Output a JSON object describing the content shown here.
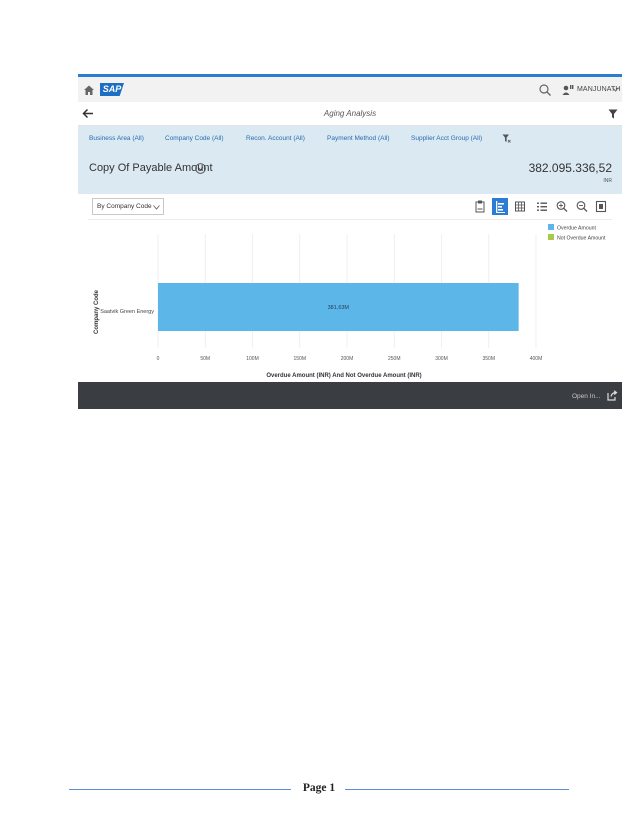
{
  "shell": {
    "logo": "SAP",
    "user_name": "MANJUNATH"
  },
  "app": {
    "title": "Aging Analysis"
  },
  "filters": [
    {
      "label": "Business Area (All)"
    },
    {
      "label": "Company Code (All)"
    },
    {
      "label": "Recon. Account (All)"
    },
    {
      "label": "Payment Method (All)"
    },
    {
      "label": "Supplier Acct Group (All)"
    }
  ],
  "kpi": {
    "title": "Copy Of Payable Amount",
    "value": "382.095.336,52",
    "unit": "INR"
  },
  "toolbar": {
    "dropdown_label": "By Company Code",
    "active_view": "bar-chart"
  },
  "colors": {
    "overdue": "#5cb6e8",
    "not_overdue": "#a8c94a",
    "accent": "#2b7cd3",
    "filter_bg": "#dbe9f2"
  },
  "chart_data": {
    "type": "bar",
    "orientation": "horizontal",
    "categories": [
      "Saatvik Green Energy"
    ],
    "series": [
      {
        "name": "Overdue Amount",
        "values": [
          381.63
        ],
        "labels": [
          "381,63M"
        ]
      },
      {
        "name": "Not Overdue Amount",
        "values": [
          0
        ],
        "labels": [
          ""
        ]
      }
    ],
    "xlabel": "Overdue Amount (INR) And Not Overdue Amount (INR)",
    "ylabel": "Company Code",
    "xlim": [
      0,
      400
    ],
    "xticks": [
      0,
      50,
      100,
      150,
      200,
      250,
      300,
      350,
      400
    ],
    "xtick_labels": [
      "0",
      "50M",
      "100M",
      "150M",
      "200M",
      "250M",
      "300M",
      "350M",
      "400M"
    ],
    "grid": true,
    "legend": "top-right"
  },
  "footer": {
    "open_in": "Open In..."
  },
  "page": {
    "number_label": "Page 1"
  }
}
